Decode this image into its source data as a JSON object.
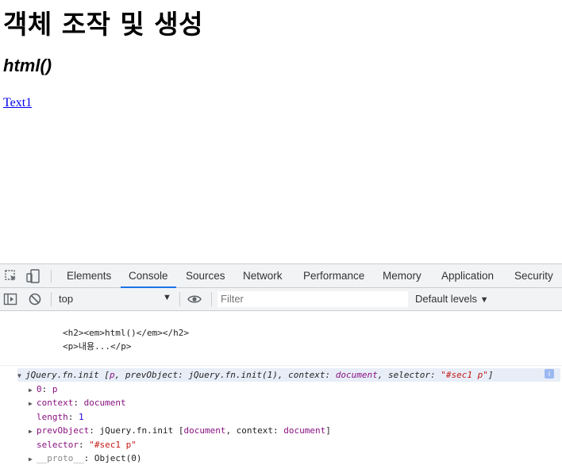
{
  "page": {
    "heading": "객체 조작 및 생성",
    "subheading": "html()",
    "link": "Text1"
  },
  "devtools": {
    "tabs": [
      "Elements",
      "Console",
      "Sources",
      "Network",
      "Performance",
      "Memory",
      "Application",
      "Security"
    ],
    "active_tab": "Console",
    "context": "top",
    "filter_placeholder": "Filter",
    "levels": "Default levels",
    "accent_color": "#1a73e8"
  },
  "console": {
    "message_lines": [
      "<h2><em>html()</em></h2>",
      "<p>내용...</p>"
    ],
    "object": {
      "summary_name": "jQuery.fn.init",
      "summary_open": " [",
      "summary_p": "p",
      "summary_mid1": ", prevObject: ",
      "summary_prev": "jQuery.fn.init(1)",
      "summary_mid2": ", context: ",
      "summary_ctx": "document",
      "summary_mid3": ", selector: ",
      "summary_sel": "\"#sec1 p\"",
      "summary_close": "]",
      "props": {
        "p0_key": "0",
        "p0_val": "p",
        "context_key": "context",
        "context_val": "document",
        "length_key": "length",
        "length_val": "1",
        "prev_key": "prevObject",
        "prev_name": "jQuery.fn.init",
        "prev_open": " [",
        "prev_doc": "document",
        "prev_mid": ", context: ",
        "prev_ctx": "document",
        "prev_close": "]",
        "selector_key": "selector",
        "selector_val": "\"#sec1 p\"",
        "proto_key": "__proto__",
        "proto_val": "Object(0)"
      }
    }
  }
}
